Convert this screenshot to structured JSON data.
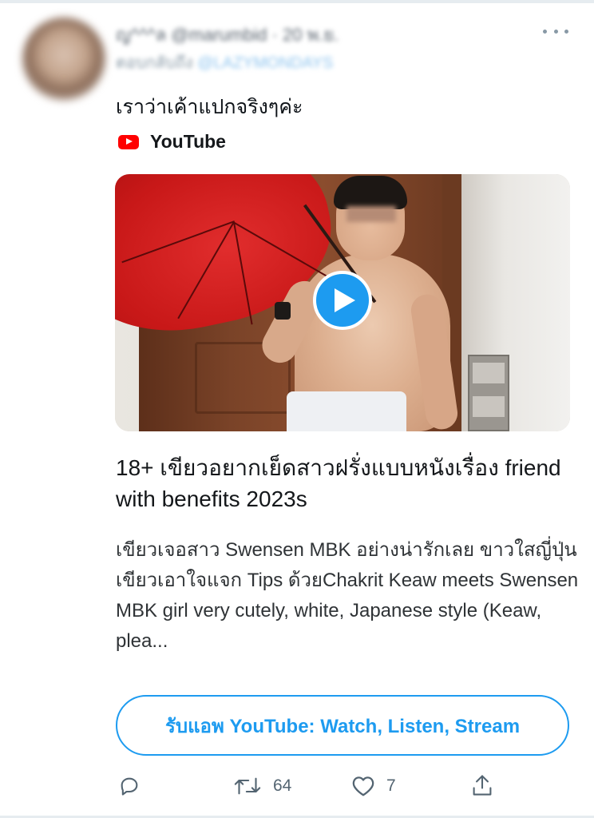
{
  "tweet": {
    "author_name": "ญ^^^ล @marumbid · 20 พ.ย.",
    "reply_context": "ตอบกลับถึง",
    "reply_mention": "@LAZYMONDAYS",
    "text": "เราว่าเค้าแปกจริงๆค่ะ",
    "more_icon": "more-horizontal-icon"
  },
  "card": {
    "source_label": "YouTube",
    "source_icon": "youtube-logo-icon",
    "title": "18+ เขียวอยากเย็ดสาวฝรั่งแบบหนังเรื่อง friend with benefits 2023s",
    "description": "เขียวเจอสาว Swensen MBK อย่างน่ารักเลย ขาวใสญี่ปุ่น เขียวเอาใจแจก Tips ด้วยChakrit Keaw meets Swensen MBK girl very cutely, white, Japanese style (Keaw, plea...",
    "play_icon": "play-icon",
    "cta_label": "รับแอพ YouTube: Watch, Listen, Stream"
  },
  "actions": {
    "reply_count": "",
    "retweet_count": "64",
    "like_count": "7",
    "share_count": ""
  },
  "colors": {
    "accent": "#1d9bf0",
    "youtube_red": "#ff0000",
    "muted": "#536471"
  }
}
